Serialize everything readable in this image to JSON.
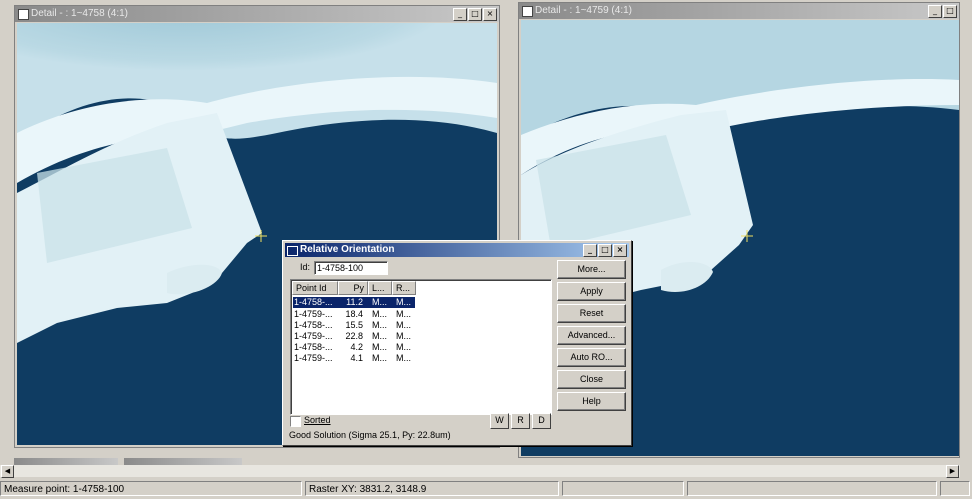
{
  "windows": {
    "left": {
      "title": "Detail - : 1~4758 (4:1)"
    },
    "right": {
      "title": "Detail - : 1~4759 (4:1)"
    }
  },
  "window_buttons": {
    "minimize": "_",
    "maximize": "□",
    "close": "×"
  },
  "dialog": {
    "title": "Relative Orientation",
    "id_label": "Id:",
    "id_value": "1-4758-100",
    "columns": [
      "Point Id",
      "Py",
      "L...",
      "R..."
    ],
    "rows": [
      {
        "id": "1-4758-...",
        "py": "11.2",
        "l": "M...",
        "r": "M...",
        "selected": true
      },
      {
        "id": "1-4759-...",
        "py": "18.4",
        "l": "M...",
        "r": "M...",
        "selected": false
      },
      {
        "id": "1-4758-...",
        "py": "15.5",
        "l": "M...",
        "r": "M...",
        "selected": false
      },
      {
        "id": "1-4759-...",
        "py": "22.8",
        "l": "M...",
        "r": "M...",
        "selected": false
      },
      {
        "id": "1-4758-...",
        "py": "4.2",
        "l": "M...",
        "r": "M...",
        "selected": false
      },
      {
        "id": "1-4759-...",
        "py": "4.1",
        "l": "M...",
        "r": "M...",
        "selected": false
      }
    ],
    "sorted_label": "Sorted",
    "small_buttons": [
      "W",
      "R",
      "D"
    ],
    "status": "Good Solution (Sigma 25.1, Py: 22.8um)",
    "buttons": [
      "More...",
      "Apply",
      "Reset",
      "Advanced...",
      "Auto RO...",
      "Close",
      "Help"
    ]
  },
  "statusbar": {
    "measure": "Measure point: 1-4758-100",
    "raster": "Raster XY: 3831.2, 3148.9"
  },
  "colors": {
    "water": "#0f3c62",
    "concrete": "#e4f0f4",
    "selection": "#0a246a"
  },
  "icons": [
    "window-icon",
    "dialog-icon",
    "crosshair-icon"
  ]
}
